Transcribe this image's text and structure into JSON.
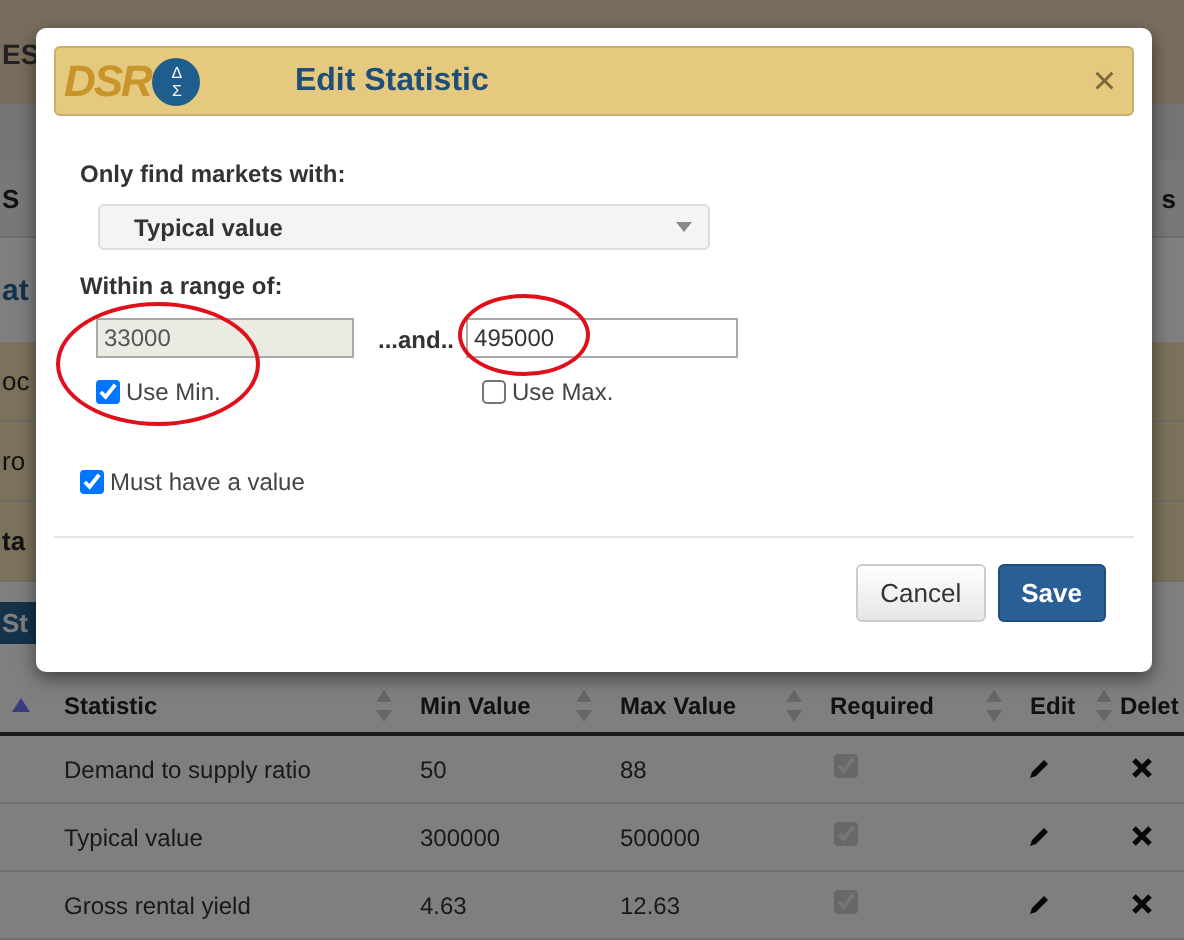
{
  "background_page": {
    "nav_fragment": "ES",
    "rows": [
      {
        "kind": "tabs",
        "left": "S",
        "right": "s"
      },
      {
        "kind": "heading",
        "left": "at"
      },
      {
        "kind": "band",
        "left": "oc"
      },
      {
        "kind": "band",
        "left": "ro"
      },
      {
        "kind": "band_bold",
        "left": "ta"
      },
      {
        "kind": "button",
        "left": "St"
      }
    ],
    "table": {
      "columns": [
        {
          "sorted": true
        },
        {
          "label": "Statistic",
          "sorted": false
        },
        {
          "label": "Min Value",
          "sorted": false
        },
        {
          "label": "Max Value",
          "sorted": false
        },
        {
          "label": "Required",
          "sorted": false
        },
        {
          "label": "Edit",
          "sorted": false
        },
        {
          "label": "Delet"
        }
      ],
      "rows": [
        {
          "statistic": "Demand to supply ratio",
          "min": "50",
          "max": "88",
          "required": true
        },
        {
          "statistic": "Typical value",
          "min": "300000",
          "max": "500000",
          "required": true
        },
        {
          "statistic": "Gross rental yield",
          "min": "4.63",
          "max": "12.63",
          "required": true
        }
      ]
    }
  },
  "dialog": {
    "logo": {
      "text": "DSR",
      "symbols": [
        "Δ",
        "Σ"
      ]
    },
    "title": "Edit Statistic",
    "close": "×",
    "market_label": "Only find markets with:",
    "statistic_select": {
      "value": "Typical value"
    },
    "range_label": "Within a range of:",
    "separator": "...and..",
    "min": {
      "value": "33000",
      "disabled": true,
      "circled": true,
      "checkbox": {
        "label": "Use Min.",
        "checked": true
      }
    },
    "max": {
      "value": "495000",
      "disabled": false,
      "circled": true,
      "checkbox": {
        "label": "Use Max.",
        "checked": false
      }
    },
    "must_have_value": {
      "label": "Must have a value",
      "checked": true
    },
    "buttons": [
      {
        "label": "Cancel",
        "kind": "default"
      },
      {
        "label": "Save",
        "kind": "primary"
      }
    ]
  }
}
